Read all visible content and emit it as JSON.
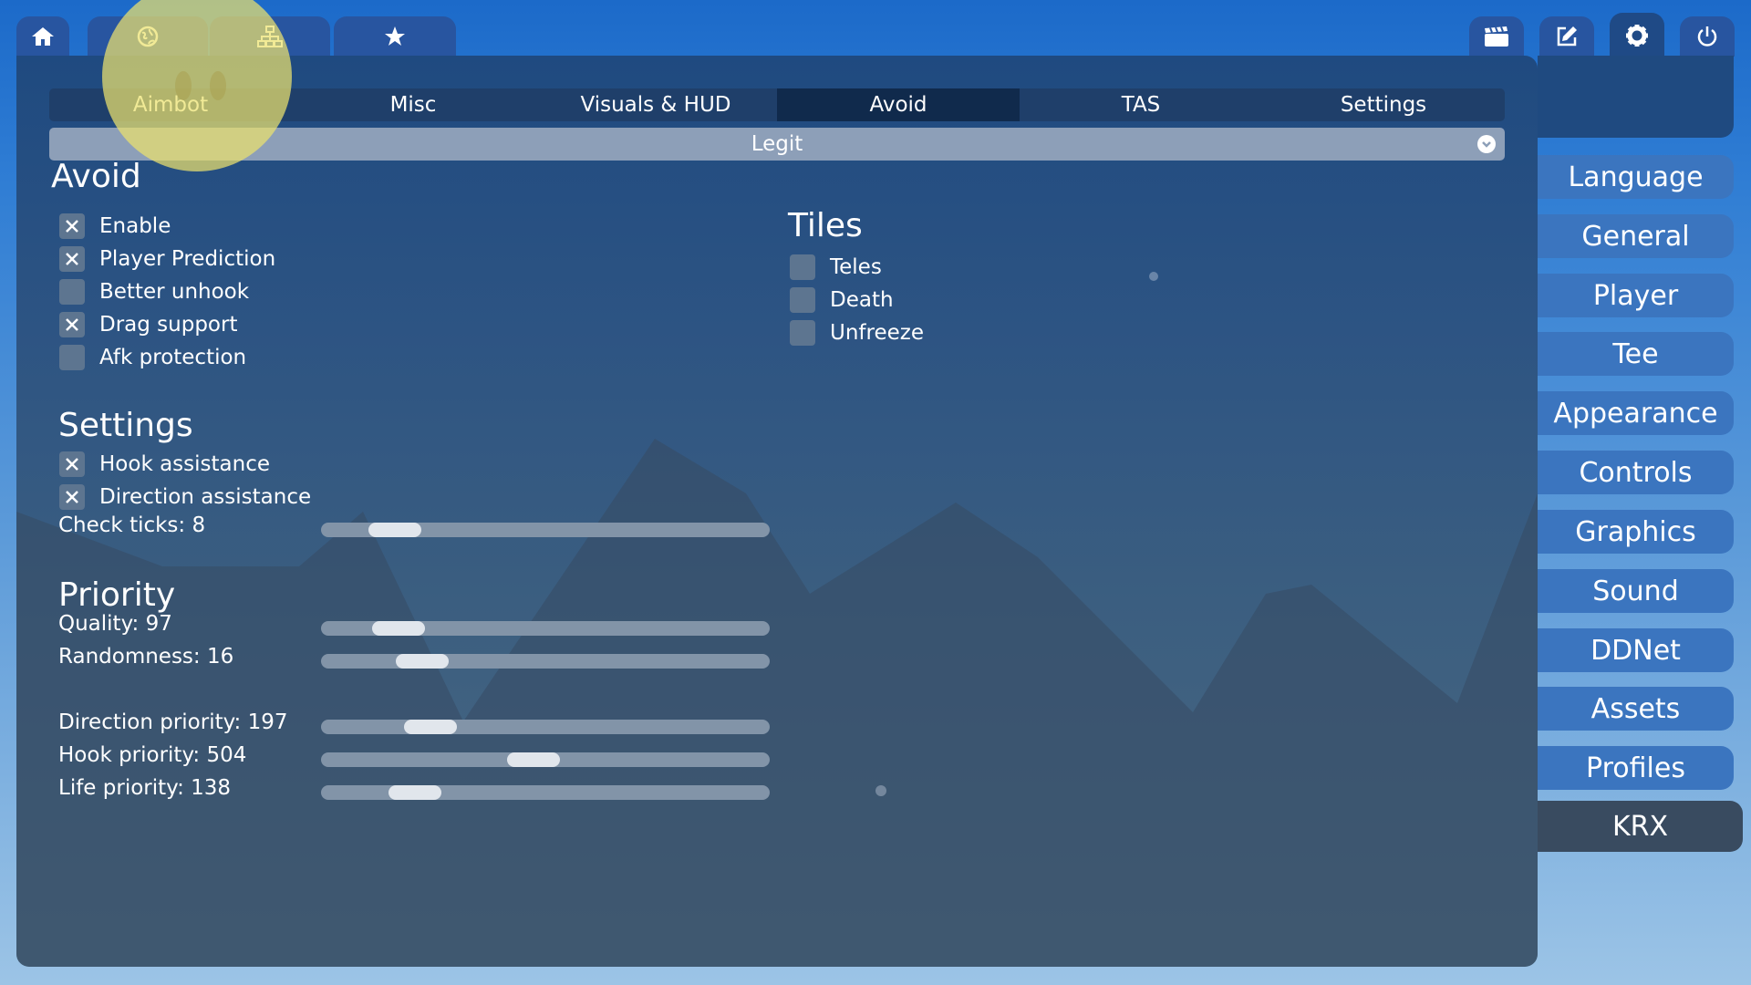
{
  "top_tabs": [
    {
      "icon": "home-icon"
    },
    {
      "icon": "globe-icon"
    },
    {
      "icon": "network-icon"
    },
    {
      "icon": "star-icon"
    }
  ],
  "top_right_buttons": [
    {
      "icon": "clapperboard-icon"
    },
    {
      "icon": "edit-icon"
    },
    {
      "icon": "gear-icon",
      "active": true
    },
    {
      "icon": "power-icon"
    }
  ],
  "subtabs": [
    "Aimbot",
    "Misc",
    "Visuals & HUD",
    "Avoid",
    "TAS",
    "Settings"
  ],
  "active_subtab": "Avoid",
  "profile_dropdown": {
    "value": "Legit"
  },
  "avoid": {
    "title": "Avoid",
    "options": [
      {
        "label": "Enable",
        "checked": true
      },
      {
        "label": "Player Prediction",
        "checked": true
      },
      {
        "label": "Better unhook",
        "checked": false
      },
      {
        "label": "Drag support",
        "checked": true
      },
      {
        "label": "Afk protection",
        "checked": false
      }
    ]
  },
  "tiles": {
    "title": "Tiles",
    "options": [
      {
        "label": "Teles",
        "checked": false
      },
      {
        "label": "Death",
        "checked": false
      },
      {
        "label": "Unfreeze",
        "checked": false
      }
    ]
  },
  "settings": {
    "title": "Settings",
    "options": [
      {
        "label": "Hook assistance",
        "checked": true
      },
      {
        "label": "Direction assistance",
        "checked": true
      }
    ],
    "check_ticks": {
      "label": "Check ticks: 8",
      "fraction": 0.12
    }
  },
  "priority": {
    "title": "Priority",
    "sliders": [
      {
        "label": "Quality: 97",
        "fraction": 0.13
      },
      {
        "label": "Randomness: 16",
        "fraction": 0.19
      },
      {
        "label": "Direction priority: 197",
        "fraction": 0.21
      },
      {
        "label": "Hook priority: 504",
        "fraction": 0.47
      },
      {
        "label": "Life priority: 138",
        "fraction": 0.17
      }
    ]
  },
  "side_menu": [
    "Language",
    "General",
    "Player",
    "Tee",
    "Appearance",
    "Controls",
    "Graphics",
    "Sound",
    "DDNet",
    "Assets",
    "Profiles",
    "KRX"
  ],
  "active_side_item": "KRX",
  "colors": {
    "accent": "#2855a0",
    "panel": "#2d5483",
    "side_button": "#3b75bf",
    "highlight": "#ece26e"
  }
}
